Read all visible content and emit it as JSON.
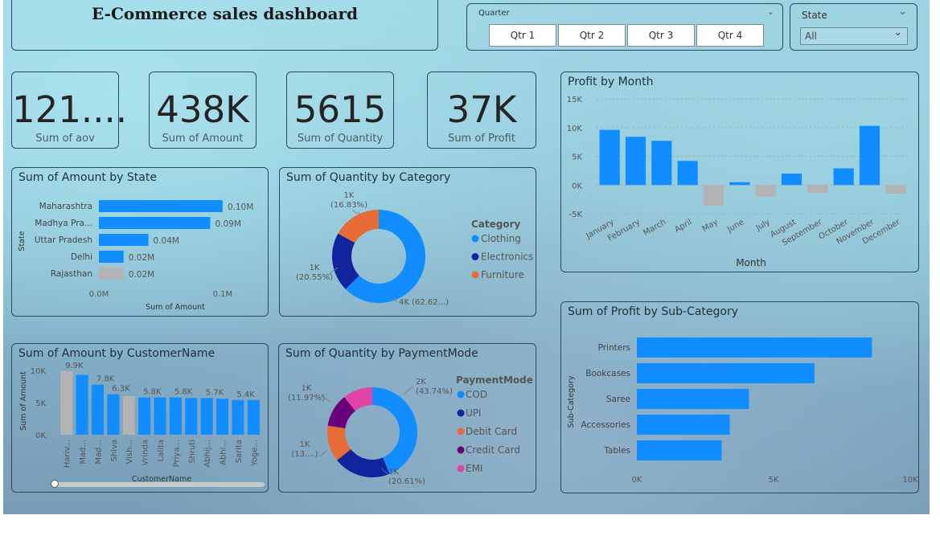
{
  "title": "E-Commerce sales dashboard",
  "filters": {
    "quarter_label": "Quarter",
    "quarters": [
      "Qtr 1",
      "Qtr 2",
      "Qtr 3",
      "Qtr 4"
    ],
    "state_label": "State",
    "state_value": "All"
  },
  "kpis": [
    {
      "value": "121....",
      "label": "Sum of aov"
    },
    {
      "value": "438K",
      "label": "Sum of Amount"
    },
    {
      "value": "5615",
      "label": "Sum of Quantity"
    },
    {
      "value": "37K",
      "label": "Sum of Profit"
    }
  ],
  "colors": {
    "blue": "#118DFF",
    "navy": "#12239E",
    "orange": "#E66C37",
    "purple": "#6B007B",
    "pink": "#E044A7",
    "gray": "#B3B3B3"
  },
  "chart_data": [
    {
      "id": "amount_by_state",
      "type": "bar",
      "orientation": "horizontal",
      "title": "Sum of Amount by State",
      "xlabel": "Sum of Amount",
      "ylabel": "State",
      "categories": [
        "Maharashtra",
        "Madhya Pra...",
        "Uttar Pradesh",
        "Delhi",
        "Rajasthan"
      ],
      "values": [
        0.1,
        0.09,
        0.04,
        0.02,
        0.02
      ],
      "value_labels": [
        "0.10M",
        "0.09M",
        "0.04M",
        "0.02M",
        "0.02M"
      ],
      "highlighted": [
        false,
        false,
        false,
        false,
        true
      ],
      "xlim": [
        0,
        0.13
      ],
      "xticks": [
        {
          "v": 0,
          "label": "0.0M"
        },
        {
          "v": 0.1,
          "label": "0.1M"
        }
      ]
    },
    {
      "id": "quantity_by_category",
      "type": "pie",
      "donut": true,
      "title": "Sum of Quantity by Category",
      "legend_title": "Category",
      "slices": [
        {
          "label": "Clothing",
          "value": 62.62,
          "data_label": "4K (62.62...)"
        },
        {
          "label": "Electronics",
          "value": 20.55,
          "data_label": "1K (20.55%)"
        },
        {
          "label": "Furniture",
          "value": 16.83,
          "data_label": "1K (16.83%)"
        }
      ]
    },
    {
      "id": "profit_by_month",
      "type": "bar",
      "title": "Profit by Month",
      "xlabel": "Month",
      "categories": [
        "January",
        "February",
        "March",
        "April",
        "May",
        "June",
        "July",
        "August",
        "September",
        "October",
        "November",
        "December"
      ],
      "values": [
        9.6,
        8.4,
        7.7,
        4.2,
        -3.6,
        0.5,
        -2.0,
        2.0,
        -1.4,
        2.9,
        10.3,
        -1.5
      ],
      "ylim": [
        -5,
        15
      ],
      "yticks": [
        {
          "v": 15,
          "label": "15K"
        },
        {
          "v": 10,
          "label": "10K"
        },
        {
          "v": 5,
          "label": "5K"
        },
        {
          "v": 0,
          "label": "0K"
        },
        {
          "v": -5,
          "label": "-5K"
        }
      ]
    },
    {
      "id": "amount_by_customer",
      "type": "bar",
      "title": "Sum of Amount by CustomerName",
      "xlabel": "CustomerName",
      "ylabel": "Sum of Amount",
      "categories": [
        "Harivansh",
        "Madhav",
        "Madan Mohan",
        "Shiva",
        "Vishakha",
        "Vrinda",
        "Lalita",
        "Priyanka",
        "Shruti",
        "Abhishek",
        "Abhijeet",
        "Sarita",
        "Yogesh"
      ],
      "tick_labels": [
        "Hariv...",
        "Mad...",
        "Mad...",
        "Shiva",
        "Vish...",
        "Vrinda",
        "Lalita",
        "Priya...",
        "Shruti",
        "Abhij...",
        "Abhi...",
        "Sarita",
        "Yoge..."
      ],
      "values": [
        9.9,
        9.3,
        7.8,
        6.3,
        6.0,
        5.8,
        5.8,
        5.8,
        5.7,
        5.7,
        5.6,
        5.4,
        5.4
      ],
      "value_labels": [
        "9.9K",
        "",
        "7.8K",
        "6.3K",
        "",
        "5.8K",
        "",
        "5.8K",
        "",
        "5.7K",
        "",
        "5.4K",
        ""
      ],
      "highlighted": [
        true,
        false,
        false,
        false,
        true,
        false,
        false,
        false,
        false,
        false,
        false,
        false,
        false
      ],
      "ylim": [
        0,
        10
      ],
      "yticks": [
        {
          "v": 10,
          "label": "10K"
        },
        {
          "v": 5,
          "label": "5K"
        },
        {
          "v": 0,
          "label": "0K"
        }
      ]
    },
    {
      "id": "quantity_by_paymentmode",
      "type": "pie",
      "donut": true,
      "title": "Sum of Quantity by PaymentMode",
      "legend_title": "PaymentMode",
      "slices": [
        {
          "label": "COD",
          "value": 43.74,
          "data_label": "2K (43.74%)"
        },
        {
          "label": "UPI",
          "value": 20.61,
          "data_label": "1K (20.61%)"
        },
        {
          "label": "Debit Card",
          "value": 13.0,
          "data_label": "1K (13....)"
        },
        {
          "label": "Credit Card",
          "value": 11.97,
          "data_label": "1K (11.97%)"
        },
        {
          "label": "EMI",
          "value": 10.68,
          "data_label": ""
        }
      ]
    },
    {
      "id": "profit_by_subcategory",
      "type": "bar",
      "orientation": "horizontal",
      "title": "Sum of Profit by Sub-Category",
      "ylabel": "Sub-Category",
      "categories": [
        "Printers",
        "Bookcases",
        "Saree",
        "Accessories",
        "Tables"
      ],
      "values": [
        8.6,
        6.5,
        4.1,
        3.4,
        3.1
      ],
      "xlim": [
        0,
        10
      ],
      "xticks": [
        {
          "v": 0,
          "label": "0K"
        },
        {
          "v": 5,
          "label": "5K"
        },
        {
          "v": 10,
          "label": "10K"
        }
      ]
    }
  ]
}
